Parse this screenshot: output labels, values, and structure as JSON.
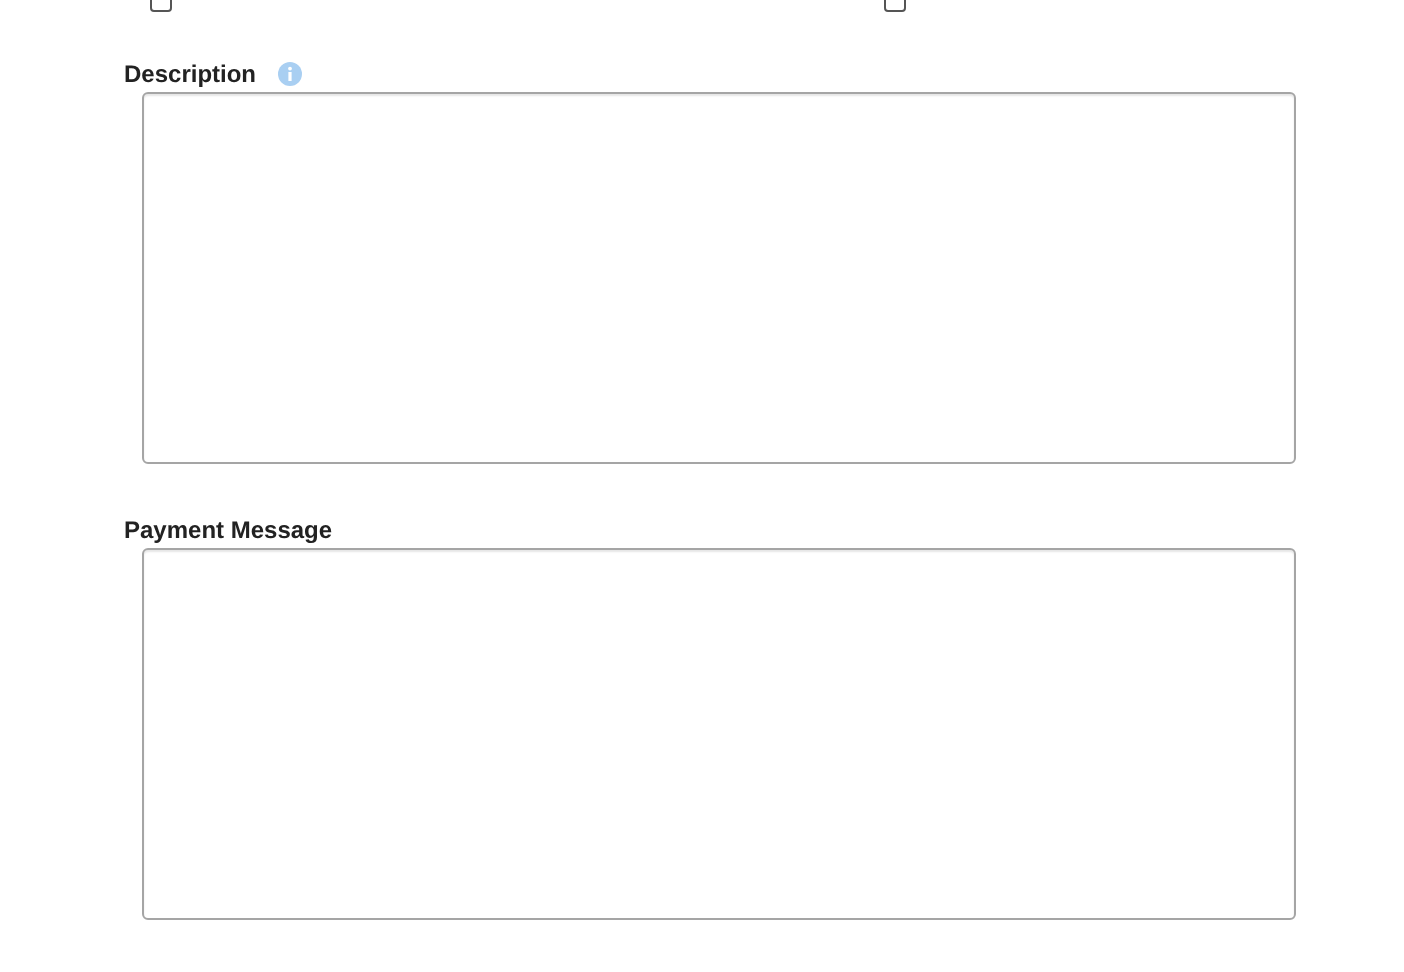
{
  "checkboxes": [
    {
      "checked": false
    },
    {
      "checked": false
    }
  ],
  "fields": [
    {
      "label": "Description",
      "info": true
    },
    {
      "label": "Payment Message",
      "info": false
    }
  ]
}
